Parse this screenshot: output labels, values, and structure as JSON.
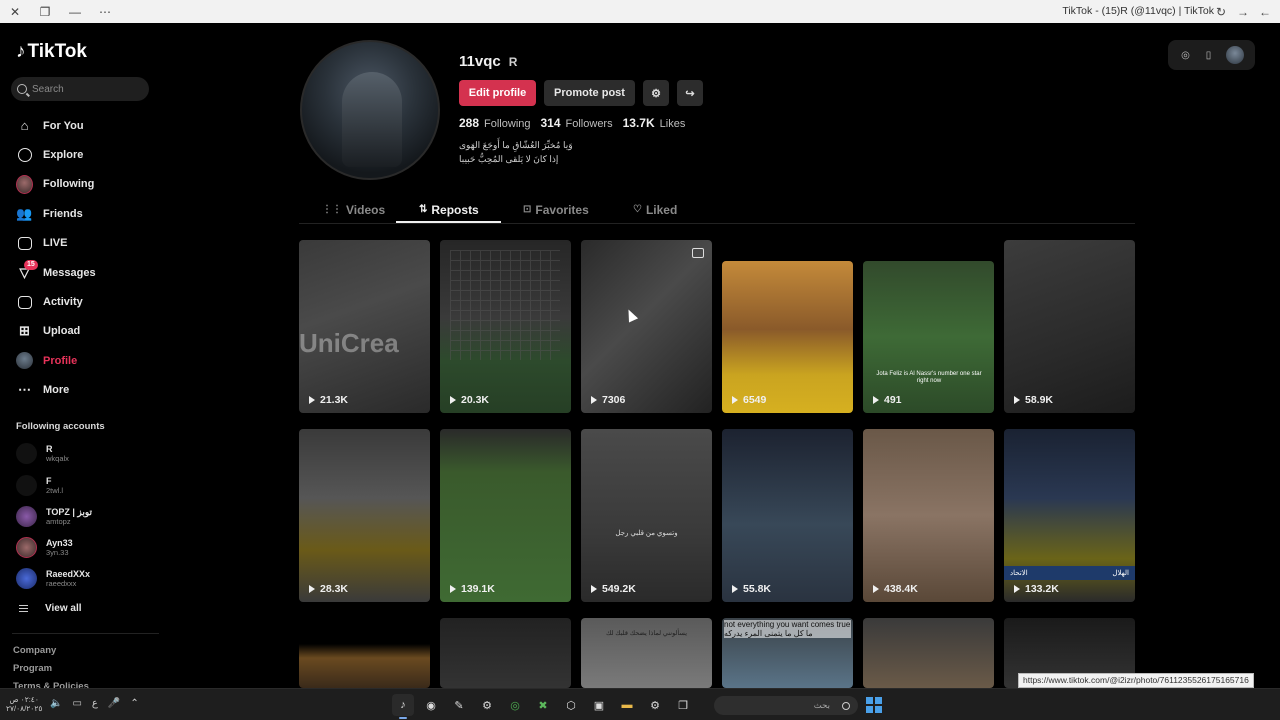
{
  "browser": {
    "title": "TikTok - (15)R (@11vqc) | TikTok",
    "close_icon": "close-icon",
    "restore_icon": "restore-icon",
    "minimize_icon": "minimize-icon",
    "more_icon": "more-dots-icon"
  },
  "sidebar": {
    "logo_text": "TikTok",
    "search_placeholder": "Search",
    "nav": [
      {
        "label": "For You",
        "icon": "home-icon"
      },
      {
        "label": "Explore",
        "icon": "compass-icon"
      },
      {
        "label": "Following",
        "icon": "following-avatar-icon"
      },
      {
        "label": "Friends",
        "icon": "friends-icon"
      },
      {
        "label": "LIVE",
        "icon": "live-icon"
      },
      {
        "label": "Messages",
        "icon": "messages-icon",
        "badge": "15"
      },
      {
        "label": "Activity",
        "icon": "activity-icon"
      },
      {
        "label": "Upload",
        "icon": "upload-icon"
      },
      {
        "label": "Profile",
        "icon": "profile-avatar-icon",
        "active": true
      },
      {
        "label": "More",
        "icon": "more-icon"
      }
    ],
    "following_title": "Following accounts",
    "following": [
      {
        "name": "R",
        "user": "wkqalx"
      },
      {
        "name": "F",
        "user": "2twl.l"
      },
      {
        "name": "TOPZ | توبز",
        "user": "amtopz"
      },
      {
        "name": "Ayn33",
        "user": "3yn.33"
      },
      {
        "name": "RaeedXXx",
        "user": "raeedxxx"
      }
    ],
    "view_all": "View all",
    "footer": [
      "Company",
      "Program",
      "Terms & Policies"
    ]
  },
  "profile": {
    "username": "11vqc",
    "nickname": "R",
    "edit_profile": "Edit profile",
    "promote_post": "Promote post",
    "following_count": "288",
    "following_label": "Following",
    "followers_count": "314",
    "followers_label": "Followers",
    "likes_count": "13.7K",
    "likes_label": "Likes",
    "bio_line1": "وَيا مُخبِّرَ العُشّاقِ ما أَوجَعَ الهَوى",
    "bio_line2": "إذا كانَ لا يَلقى المُحِبُّ حَبيبا"
  },
  "tabs": [
    {
      "label": "Videos",
      "icon": "grid-icon"
    },
    {
      "label": "Reposts",
      "icon": "repost-icon",
      "active": true
    },
    {
      "label": "Favorites",
      "icon": "bookmark-icon"
    },
    {
      "label": "Liked",
      "icon": "heart-outline-icon"
    }
  ],
  "videos": [
    {
      "views": "21.3K",
      "overlay": "UniCrea"
    },
    {
      "views": "20.3K"
    },
    {
      "views": "7306",
      "pinned": true
    },
    {
      "views": "6549"
    },
    {
      "views": "491",
      "caption": "Jota Feliz is Al Nassr's number one star right now"
    },
    {
      "views": "58.9K"
    },
    {
      "views": "28.3K"
    },
    {
      "views": "139.1K"
    },
    {
      "views": "549.2K",
      "caption": "وتسوي من قلبي رجل"
    },
    {
      "views": "55.8K"
    },
    {
      "views": "438.4K"
    },
    {
      "views": "133.2K",
      "score_left": "الاتحاد",
      "score_right": "الهلال"
    },
    {
      "views": ""
    },
    {
      "views": ""
    },
    {
      "views": "",
      "caption": "يسألونني لماذا يضحك قلبك لك"
    },
    {
      "views": "",
      "caption": "not everything you want comes true ما كل ما يتمنى المرء يدركه"
    },
    {
      "views": ""
    },
    {
      "views": ""
    }
  ],
  "status_url": "https://www.tiktok.com/@i2izr/photo/7611235526175165716",
  "taskbar": {
    "time": "٠٢:٤٠ ص",
    "date": "٢٧/٠٨/٢٠٢٥",
    "search_placeholder": "بحث",
    "lang": "ع"
  }
}
